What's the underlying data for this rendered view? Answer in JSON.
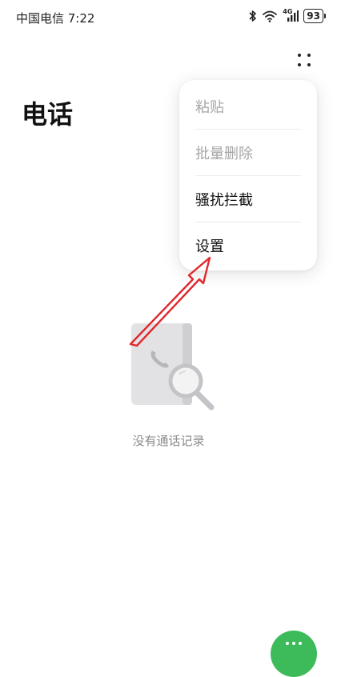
{
  "status_bar": {
    "carrier_time": "中国电信 7:22",
    "network_label": "4G",
    "battery_level": "93"
  },
  "header": {
    "title": "电话"
  },
  "menu": {
    "items": [
      {
        "label": "粘贴",
        "enabled": false
      },
      {
        "label": "批量删除",
        "enabled": false
      },
      {
        "label": "骚扰拦截",
        "enabled": true
      },
      {
        "label": "设置",
        "enabled": true
      }
    ]
  },
  "empty_state": {
    "text": "没有通话记录"
  },
  "colors": {
    "accent_green": "#3dbb5a",
    "annotation_red": "#e0282e",
    "disabled_text": "#a6a6a6"
  }
}
